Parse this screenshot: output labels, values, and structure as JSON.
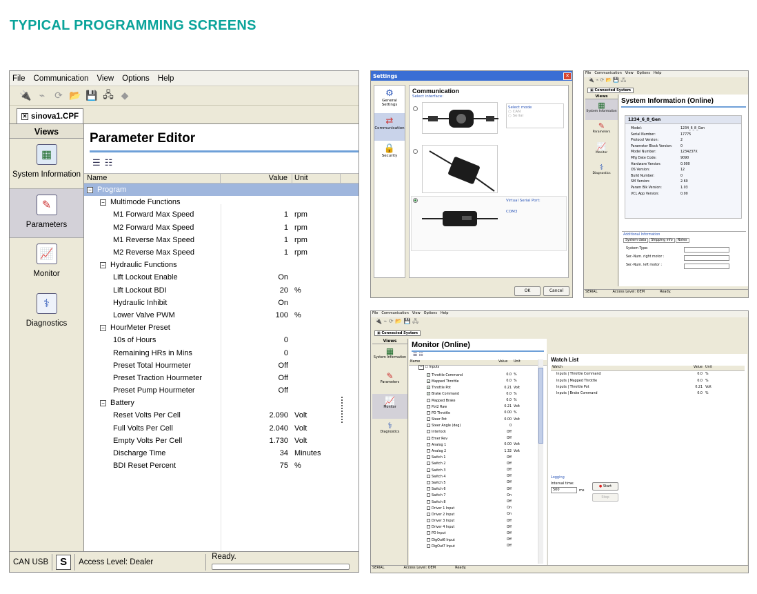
{
  "page_title": "TYPICAL PROGRAMMING SCREENS",
  "main": {
    "menu": [
      "File",
      "Communication",
      "View",
      "Options",
      "Help"
    ],
    "file_tab": "sinova1.CPF",
    "views_header": "Views",
    "views": [
      {
        "label": "System Information",
        "icon": "system-information-icon"
      },
      {
        "label": "Parameters",
        "icon": "parameters-icon",
        "selected": true
      },
      {
        "label": "Monitor",
        "icon": "monitor-icon"
      },
      {
        "label": "Diagnostics",
        "icon": "diagnostics-icon"
      }
    ],
    "editor_title": "Parameter Editor",
    "columns": {
      "name": "Name",
      "value": "Value",
      "unit": "Unit"
    },
    "rows": [
      {
        "level": 0,
        "group": true,
        "name": "Program",
        "value": "",
        "unit": "",
        "selected": true
      },
      {
        "level": 1,
        "group": true,
        "name": "Multimode Functions",
        "value": "",
        "unit": ""
      },
      {
        "level": 2,
        "name": "M1 Forward Max Speed",
        "value": "1",
        "unit": "rpm"
      },
      {
        "level": 2,
        "name": "M2 Forward Max Speed",
        "value": "1",
        "unit": "rpm"
      },
      {
        "level": 2,
        "name": "M1 Reverse Max Speed",
        "value": "1",
        "unit": "rpm"
      },
      {
        "level": 2,
        "name": "M2 Reverse Max Speed",
        "value": "1",
        "unit": "rpm"
      },
      {
        "level": 1,
        "group": true,
        "name": "Hydraulic Functions",
        "value": "",
        "unit": ""
      },
      {
        "level": 2,
        "name": "Lift Lockout Enable",
        "value": "On",
        "unit": ""
      },
      {
        "level": 2,
        "name": "Lift Lockout BDI",
        "value": "20",
        "unit": "%"
      },
      {
        "level": 2,
        "name": "Hydraulic Inhibit",
        "value": "On",
        "unit": ""
      },
      {
        "level": 2,
        "name": "Lower Valve PWM",
        "value": "100",
        "unit": "%"
      },
      {
        "level": 1,
        "group": true,
        "name": "HourMeter Preset",
        "value": "",
        "unit": ""
      },
      {
        "level": 2,
        "name": "10s of Hours",
        "value": "0",
        "unit": ""
      },
      {
        "level": 2,
        "name": "Remaining HRs in Mins",
        "value": "0",
        "unit": ""
      },
      {
        "level": 2,
        "name": "Preset Total Hourmeter",
        "value": "Off",
        "unit": ""
      },
      {
        "level": 2,
        "name": "Preset Traction Hourmeter",
        "value": "Off",
        "unit": ""
      },
      {
        "level": 2,
        "name": "Preset Pump Hourmeter",
        "value": "Off",
        "unit": ""
      },
      {
        "level": 1,
        "group": true,
        "name": "Battery",
        "value": "",
        "unit": ""
      },
      {
        "level": 2,
        "name": "Reset Volts Per Cell",
        "value": "2.090",
        "unit": "Volt"
      },
      {
        "level": 2,
        "name": "Full Volts Per Cell",
        "value": "2.040",
        "unit": "Volt"
      },
      {
        "level": 2,
        "name": "Empty Volts Per Cell",
        "value": "1.730",
        "unit": "Volt"
      },
      {
        "level": 2,
        "name": "Discharge Time",
        "value": "34",
        "unit": "Minutes"
      },
      {
        "level": 2,
        "name": "BDI Reset Percent",
        "value": "75",
        "unit": "%"
      }
    ],
    "status": {
      "port": "CAN USB",
      "mode": "S",
      "access": "Access Level: Dealer",
      "ready": "Ready."
    }
  },
  "settings": {
    "title": "Settings",
    "side": [
      "General Settings",
      "Communication",
      "Security"
    ],
    "heading": "Communication",
    "select_interface": "Select interface:",
    "select_mode": "Select mode",
    "modes": [
      "CAN",
      "Serial"
    ],
    "virtual_port": "Virtual Serial Port:",
    "com": "COM3",
    "ok": "OK",
    "cancel": "Cancel"
  },
  "sysinfo": {
    "menu": [
      "File",
      "Communication",
      "View",
      "Options",
      "Help"
    ],
    "tab": "Connected System",
    "views_header": "Views",
    "views": [
      "System Information",
      "Parameters",
      "Monitor",
      "Diagnostics"
    ],
    "heading": "System Information (Online)",
    "device": "1234_6_8_Gen",
    "fields": [
      {
        "k": "Model:",
        "v": "1234_6_8_Gen"
      },
      {
        "k": "Serial Number:",
        "v": "17775"
      },
      {
        "k": "Protocol Version:",
        "v": "2"
      },
      {
        "k": "Parameter Block Version:",
        "v": "0"
      },
      {
        "k": "Model Number:",
        "v": "1234237X"
      },
      {
        "k": "Mfg Date Code:",
        "v": "9090"
      },
      {
        "k": "Hardware Version:",
        "v": "0.000"
      },
      {
        "k": "OS Version:",
        "v": "12"
      },
      {
        "k": "Build Number:",
        "v": "0"
      },
      {
        "k": "SM Version:",
        "v": "2.60"
      },
      {
        "k": "Param Blk Version:",
        "v": "1.03"
      },
      {
        "k": "VCL App Version:",
        "v": "0.00"
      }
    ],
    "additional": "Additional Information",
    "subtabs": [
      "System data",
      "Shipping info",
      "Notes"
    ],
    "system_type": "System Type:",
    "ser_right": "Ser.-Num. right motor :",
    "ser_left": "Ser.-Num. left motor :",
    "status_left": "SERIAL",
    "status_access": "Access Level: OEM",
    "status_ready": "Ready."
  },
  "monitor": {
    "menu": [
      "File",
      "Communication",
      "View",
      "Options",
      "Help"
    ],
    "tab": "Connected System",
    "views_header": "Views",
    "views": [
      "System Information",
      "Parameters",
      "Monitor",
      "Diagnostics"
    ],
    "heading": "Monitor (Online)",
    "columns": {
      "name": "Name",
      "value": "Value",
      "unit": "Unit"
    },
    "root": "Inputs",
    "rows": [
      {
        "name": "Throttle Command",
        "value": "0.0",
        "unit": "%",
        "checked": true
      },
      {
        "name": "Mapped Throttle",
        "value": "0.0",
        "unit": "%",
        "checked": true
      },
      {
        "name": "Throttle Pot",
        "value": "0.21",
        "unit": "Volt",
        "checked": true
      },
      {
        "name": "Brake Command",
        "value": "0.0",
        "unit": "%",
        "checked": true
      },
      {
        "name": "Mapped Brake",
        "value": "0.0",
        "unit": "%"
      },
      {
        "name": "Pot2 Raw",
        "value": "0.21",
        "unit": "Volt"
      },
      {
        "name": "PD Throttle",
        "value": "0.00",
        "unit": "%"
      },
      {
        "name": "Steer Pot",
        "value": "0.00",
        "unit": "Volt"
      },
      {
        "name": "Steer Angle (deg)",
        "value": "0",
        "unit": ""
      },
      {
        "name": "Interlock",
        "value": "Off",
        "unit": ""
      },
      {
        "name": "Emer Rev",
        "value": "Off",
        "unit": ""
      },
      {
        "name": "Analog 1",
        "value": "0.00",
        "unit": "Volt"
      },
      {
        "name": "Analog 2",
        "value": "1.32",
        "unit": "Volt"
      },
      {
        "name": "Switch 1",
        "value": "Off",
        "unit": ""
      },
      {
        "name": "Switch 2",
        "value": "Off",
        "unit": ""
      },
      {
        "name": "Switch 3",
        "value": "Off",
        "unit": ""
      },
      {
        "name": "Switch 4",
        "value": "Off",
        "unit": ""
      },
      {
        "name": "Switch 5",
        "value": "Off",
        "unit": ""
      },
      {
        "name": "Switch 6",
        "value": "Off",
        "unit": ""
      },
      {
        "name": "Switch 7",
        "value": "On",
        "unit": ""
      },
      {
        "name": "Switch 8",
        "value": "Off",
        "unit": ""
      },
      {
        "name": "Driver 1 Input",
        "value": "On",
        "unit": ""
      },
      {
        "name": "Driver 2 Input",
        "value": "On",
        "unit": ""
      },
      {
        "name": "Driver 3 Input",
        "value": "Off",
        "unit": ""
      },
      {
        "name": "Driver 4 Input",
        "value": "Off",
        "unit": ""
      },
      {
        "name": "PD Input",
        "value": "Off",
        "unit": ""
      },
      {
        "name": "DigOut6 Input",
        "value": "Off",
        "unit": ""
      },
      {
        "name": "DigOut7 Input",
        "value": "Off",
        "unit": ""
      }
    ],
    "watch_title": "Watch List",
    "watch_columns": {
      "watch": "Watch",
      "value": "Value",
      "unit": "Unit"
    },
    "watch": [
      {
        "name": "Inputs | Throttle Command",
        "value": "0.0",
        "unit": "%"
      },
      {
        "name": "Inputs | Mapped Throttle",
        "value": "0.0",
        "unit": "%"
      },
      {
        "name": "Inputs | Throttle Pot",
        "value": "0.21",
        "unit": "Volt"
      },
      {
        "name": "Inputs | Brake Command",
        "value": "0.0",
        "unit": "%"
      }
    ],
    "logging": "Logging",
    "interval": "Interval time:",
    "interval_value": "500",
    "ms": "ms",
    "start": "Start",
    "stop": "Stop",
    "status_left": "SERIAL",
    "status_access": "Access Level: OEM",
    "status_ready": "Ready."
  }
}
